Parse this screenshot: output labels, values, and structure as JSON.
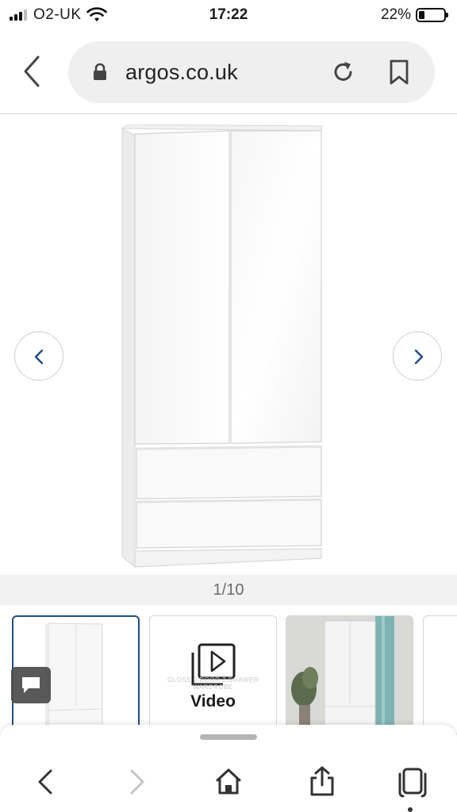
{
  "status_bar": {
    "carrier": "O2-UK",
    "time": "17:22",
    "battery": "22%",
    "battery_level": 0.22
  },
  "browser": {
    "url": "argos.co.uk",
    "icons": {
      "back": "chevron-left-icon",
      "lock": "lock-icon",
      "reload": "reload-icon",
      "bookmark": "bookmark-icon"
    }
  },
  "gallery": {
    "counter": "1/10",
    "prev": "chevron-left-icon",
    "next": "chevron-right-icon"
  },
  "thumbnails": [
    {
      "type": "image"
    },
    {
      "type": "video",
      "label": "Video",
      "watermark": "GLOSS 2 DOOR 2 DRAWER WARDROBE"
    },
    {
      "type": "image"
    },
    {
      "type": "image"
    }
  ],
  "toolbar": {
    "items": [
      "back-icon",
      "forward-icon",
      "home-icon",
      "share-icon",
      "tabs-icon"
    ]
  },
  "colors": {
    "accent": "#1c4f8b",
    "url_bar_bg": "#efefef",
    "counter_bg": "#f2f2f2"
  }
}
